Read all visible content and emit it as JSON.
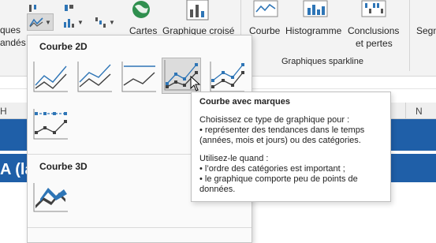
{
  "ribbon": {
    "left_labels": [
      "ques",
      "andés"
    ],
    "maps_label": "Cartes",
    "pivot_chart_label": "Graphique croisé",
    "sparkline_line_label": "Courbe",
    "sparkline_column_label": "Histogramme",
    "sparkline_winloss_line1": "Conclusions",
    "sparkline_winloss_line2": "et pertes",
    "slicer_label": "Segm",
    "sparkline_group_label": "Graphiques sparkline"
  },
  "sheet": {
    "col_left": "H",
    "col_right": "N",
    "cell_text": "A (la"
  },
  "dropdown": {
    "section_2d": "Courbe 2D",
    "section_3d": "Courbe 3D",
    "thumbs_2d": [
      "line-chart-icon",
      "stacked-line-chart-icon",
      "percent-stacked-line-chart-icon",
      "line-with-markers-chart-icon",
      "stacked-line-with-markers-chart-icon",
      "percent-stacked-line-with-markers-chart-icon"
    ],
    "active_index": 3
  },
  "tooltip": {
    "title": "Courbe avec marques",
    "lines_a": [
      "Choisissez ce type de graphique pour :",
      "• représenter des tendances dans le temps",
      "(années, mois et jours) ou des catégories."
    ],
    "lines_b": [
      "Utilisez-le quand :",
      "• l’ordre des catégories est important ;",
      "• le graphique comporte peu de points de",
      "données."
    ]
  },
  "colors": {
    "accent_blue": "#2e75b6",
    "band_blue": "#1f5fa8",
    "marker_dark": "#404040"
  }
}
